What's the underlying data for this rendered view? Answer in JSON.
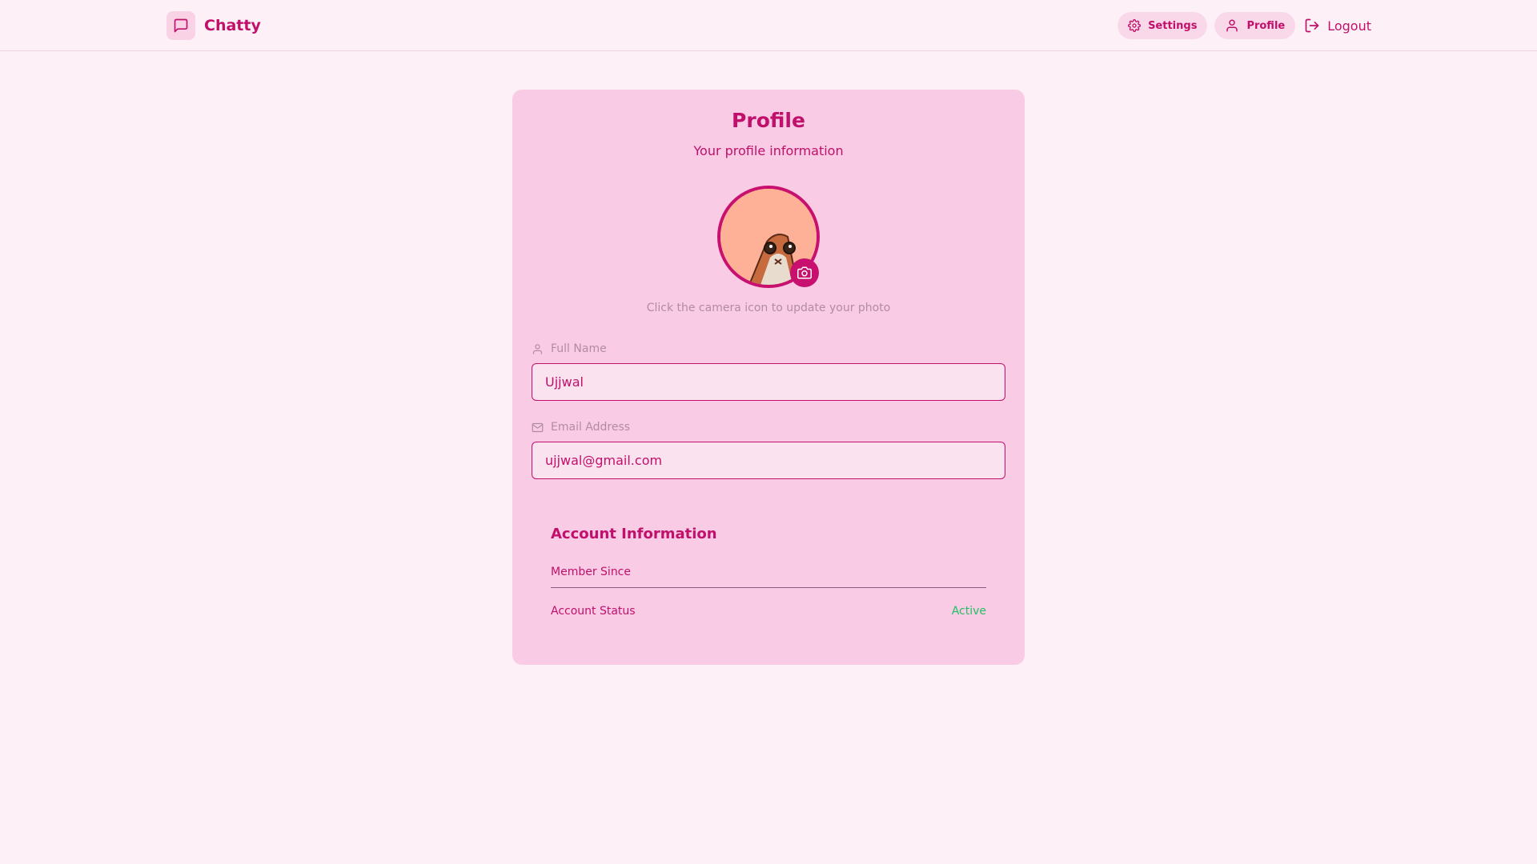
{
  "nav": {
    "brand": "Chatty",
    "settings_label": "Settings",
    "profile_label": "Profile",
    "logout_label": "Logout"
  },
  "profile": {
    "title": "Profile",
    "subtitle": "Your profile information",
    "photo_hint": "Click the camera icon to update your photo"
  },
  "fields": {
    "full_name": {
      "label": "Full Name",
      "value": "Ujjwal"
    },
    "email": {
      "label": "Email Address",
      "value": "ujjwal@gmail.com"
    }
  },
  "account": {
    "title": "Account Information",
    "member_since_label": "Member Since",
    "member_since_value": "",
    "status_label": "Account Status",
    "status_value": "Active"
  },
  "colors": {
    "accent": "#c0106b",
    "background": "#fdf1f7",
    "card": "#f9cbe4",
    "status_active": "#22c065"
  }
}
